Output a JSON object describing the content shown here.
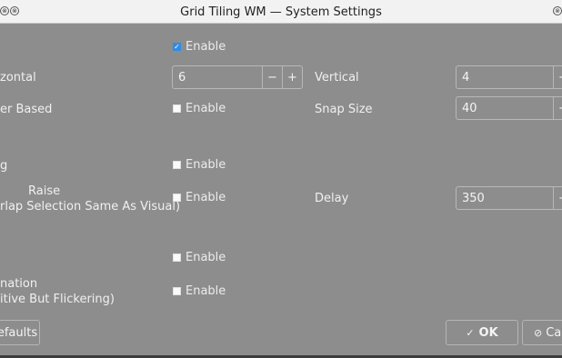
{
  "window": {
    "title": "Grid Tiling WM — System Settings"
  },
  "rows": {
    "enable_top": {
      "checkbox_label": "Enable",
      "checked": true
    },
    "horizontal": {
      "label": "zontal",
      "value": "6",
      "vertical_label": "Vertical",
      "vertical_value": "4"
    },
    "border_based": {
      "label": "er Based",
      "checkbox_label": "Enable",
      "snap_label": "Snap Size",
      "snap_value": "40"
    },
    "tiling": {
      "label": "g",
      "checkbox_label": "Enable"
    },
    "raise": {
      "label_line1": "Raise",
      "label_line2": "rlap Selection Same As Visual)",
      "checkbox_label": "Enable",
      "delay_label": "Delay",
      "delay_value": "350"
    },
    "unlabeled": {
      "checkbox_label": "Enable"
    },
    "animation": {
      "label_line1": "nation",
      "label_line2": "itive But Flickering)",
      "checkbox_label": "Enable"
    }
  },
  "buttons": {
    "defaults": "efaults",
    "ok": "OK",
    "cancel": "Ca"
  },
  "icons": {
    "minus": "−",
    "plus": "+",
    "check": "✓",
    "cancel": "⊘"
  }
}
